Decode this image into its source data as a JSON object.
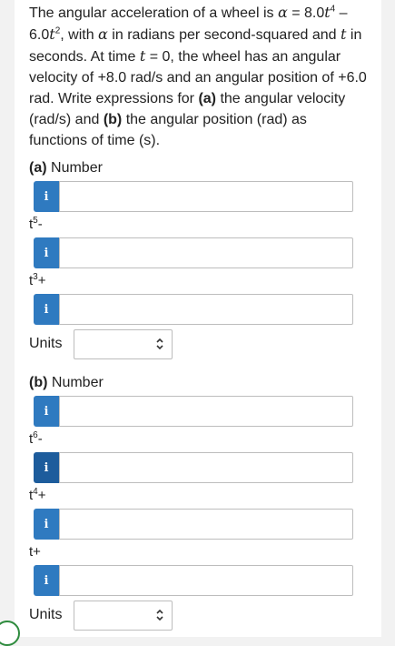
{
  "question": {
    "p1": "The angular acceleration of a wheel is ",
    "alpha": "α",
    "p2": " = 8.0",
    "t1": "t",
    "exp1": "4",
    "p3": " – 6.0",
    "t2": "t",
    "exp2": "2",
    "p4": ", with ",
    "alpha2": "α",
    "p5": " in radians per second-squared and ",
    "t3": "t",
    "p6": " in seconds. At time ",
    "t4": "t",
    "p7": " = 0, the wheel has an angular velocity of +8.0 rad/s and an angular position of +6.0 rad. Write expressions for ",
    "part_a": "(a)",
    "p8": " the angular velocity (rad/s) and ",
    "part_b": "(b)",
    "p9": " the angular position (rad) as functions of time (s)."
  },
  "part_a": {
    "bold": "(a)",
    "label": " Number",
    "terms": [
      {
        "base": "t",
        "exp": "5",
        "suffix": "-"
      },
      {
        "base": "t",
        "exp": "3",
        "suffix": "+"
      }
    ],
    "units_label": "Units"
  },
  "part_b": {
    "bold": "(b)",
    "label": " Number",
    "terms": [
      {
        "base": "t",
        "exp": "6",
        "suffix": "-"
      },
      {
        "base": "t",
        "exp": "4",
        "suffix": "+"
      },
      {
        "base": "t",
        "exp": "",
        "suffix": "+"
      }
    ],
    "units_label": "Units"
  },
  "info_icon_glyph": "i",
  "colors": {
    "info_button": "#2f7ac0",
    "info_button_active": "#1d5c9c",
    "avatar_ring": "#2e8b3e"
  }
}
